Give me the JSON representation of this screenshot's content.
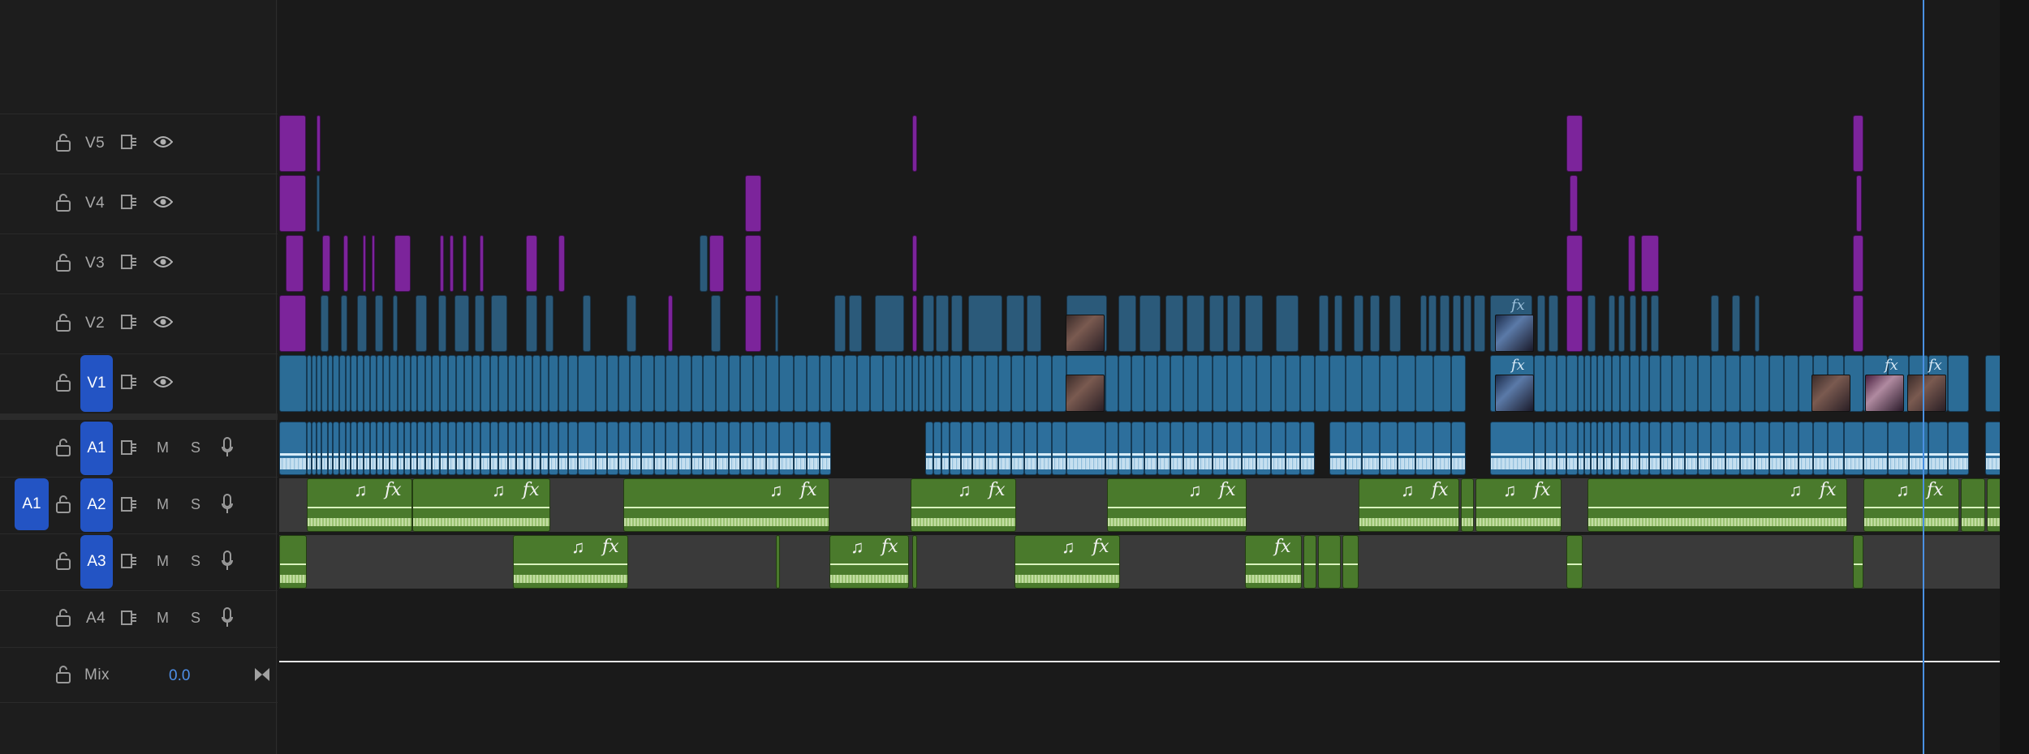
{
  "tracks": {
    "video": [
      {
        "name": "V5"
      },
      {
        "name": "V4"
      },
      {
        "name": "V3"
      },
      {
        "name": "V2"
      },
      {
        "name": "V1",
        "targeted": true
      }
    ],
    "audio": [
      {
        "name": "A1",
        "targeted": true,
        "mute": "M",
        "solo": "S"
      },
      {
        "name": "A2",
        "targeted": true,
        "mute": "M",
        "solo": "S"
      },
      {
        "name": "A3",
        "targeted": true,
        "mute": "M",
        "solo": "S"
      },
      {
        "name": "A4",
        "targeted": false,
        "mute": "M",
        "solo": "S"
      }
    ],
    "source_patch": "A1",
    "mix": {
      "label": "Mix",
      "value": "0.0"
    }
  },
  "clip_glyphs": {
    "fx": "fx",
    "music": "♫"
  },
  "colors": {
    "video_clip": "#2b6c96",
    "adjustment_clip": "#7c249b",
    "audio_clip_green": "#4a7a2c",
    "audio_clip_blue": "#2d6f9c",
    "playhead": "#4a90e2",
    "target_button": "#2354c4"
  }
}
